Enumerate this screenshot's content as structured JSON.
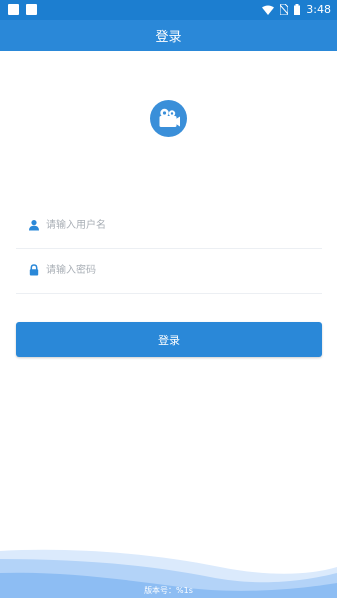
{
  "status_bar": {
    "time": "3:48",
    "icons": [
      "notification-square-icon",
      "notification-square-icon",
      "wifi-icon",
      "no-sim-icon",
      "battery-icon"
    ]
  },
  "app_bar": {
    "title": "登录"
  },
  "logo": {
    "icon": "video-camera-icon",
    "color": "#3a8fd9"
  },
  "form": {
    "username": {
      "icon": "user-icon",
      "placeholder": "请输入用户名",
      "value": ""
    },
    "password": {
      "icon": "lock-icon",
      "placeholder": "请输入密码",
      "value": ""
    },
    "login_button": "登录"
  },
  "footer": {
    "version_label": "版本号：%1s"
  },
  "colors": {
    "primary": "#2a88d8",
    "status_bar": "#1c7ed0",
    "placeholder": "#a9afb6",
    "wave_light": "#cfe3fb",
    "wave_dark": "#8dbdf3"
  }
}
